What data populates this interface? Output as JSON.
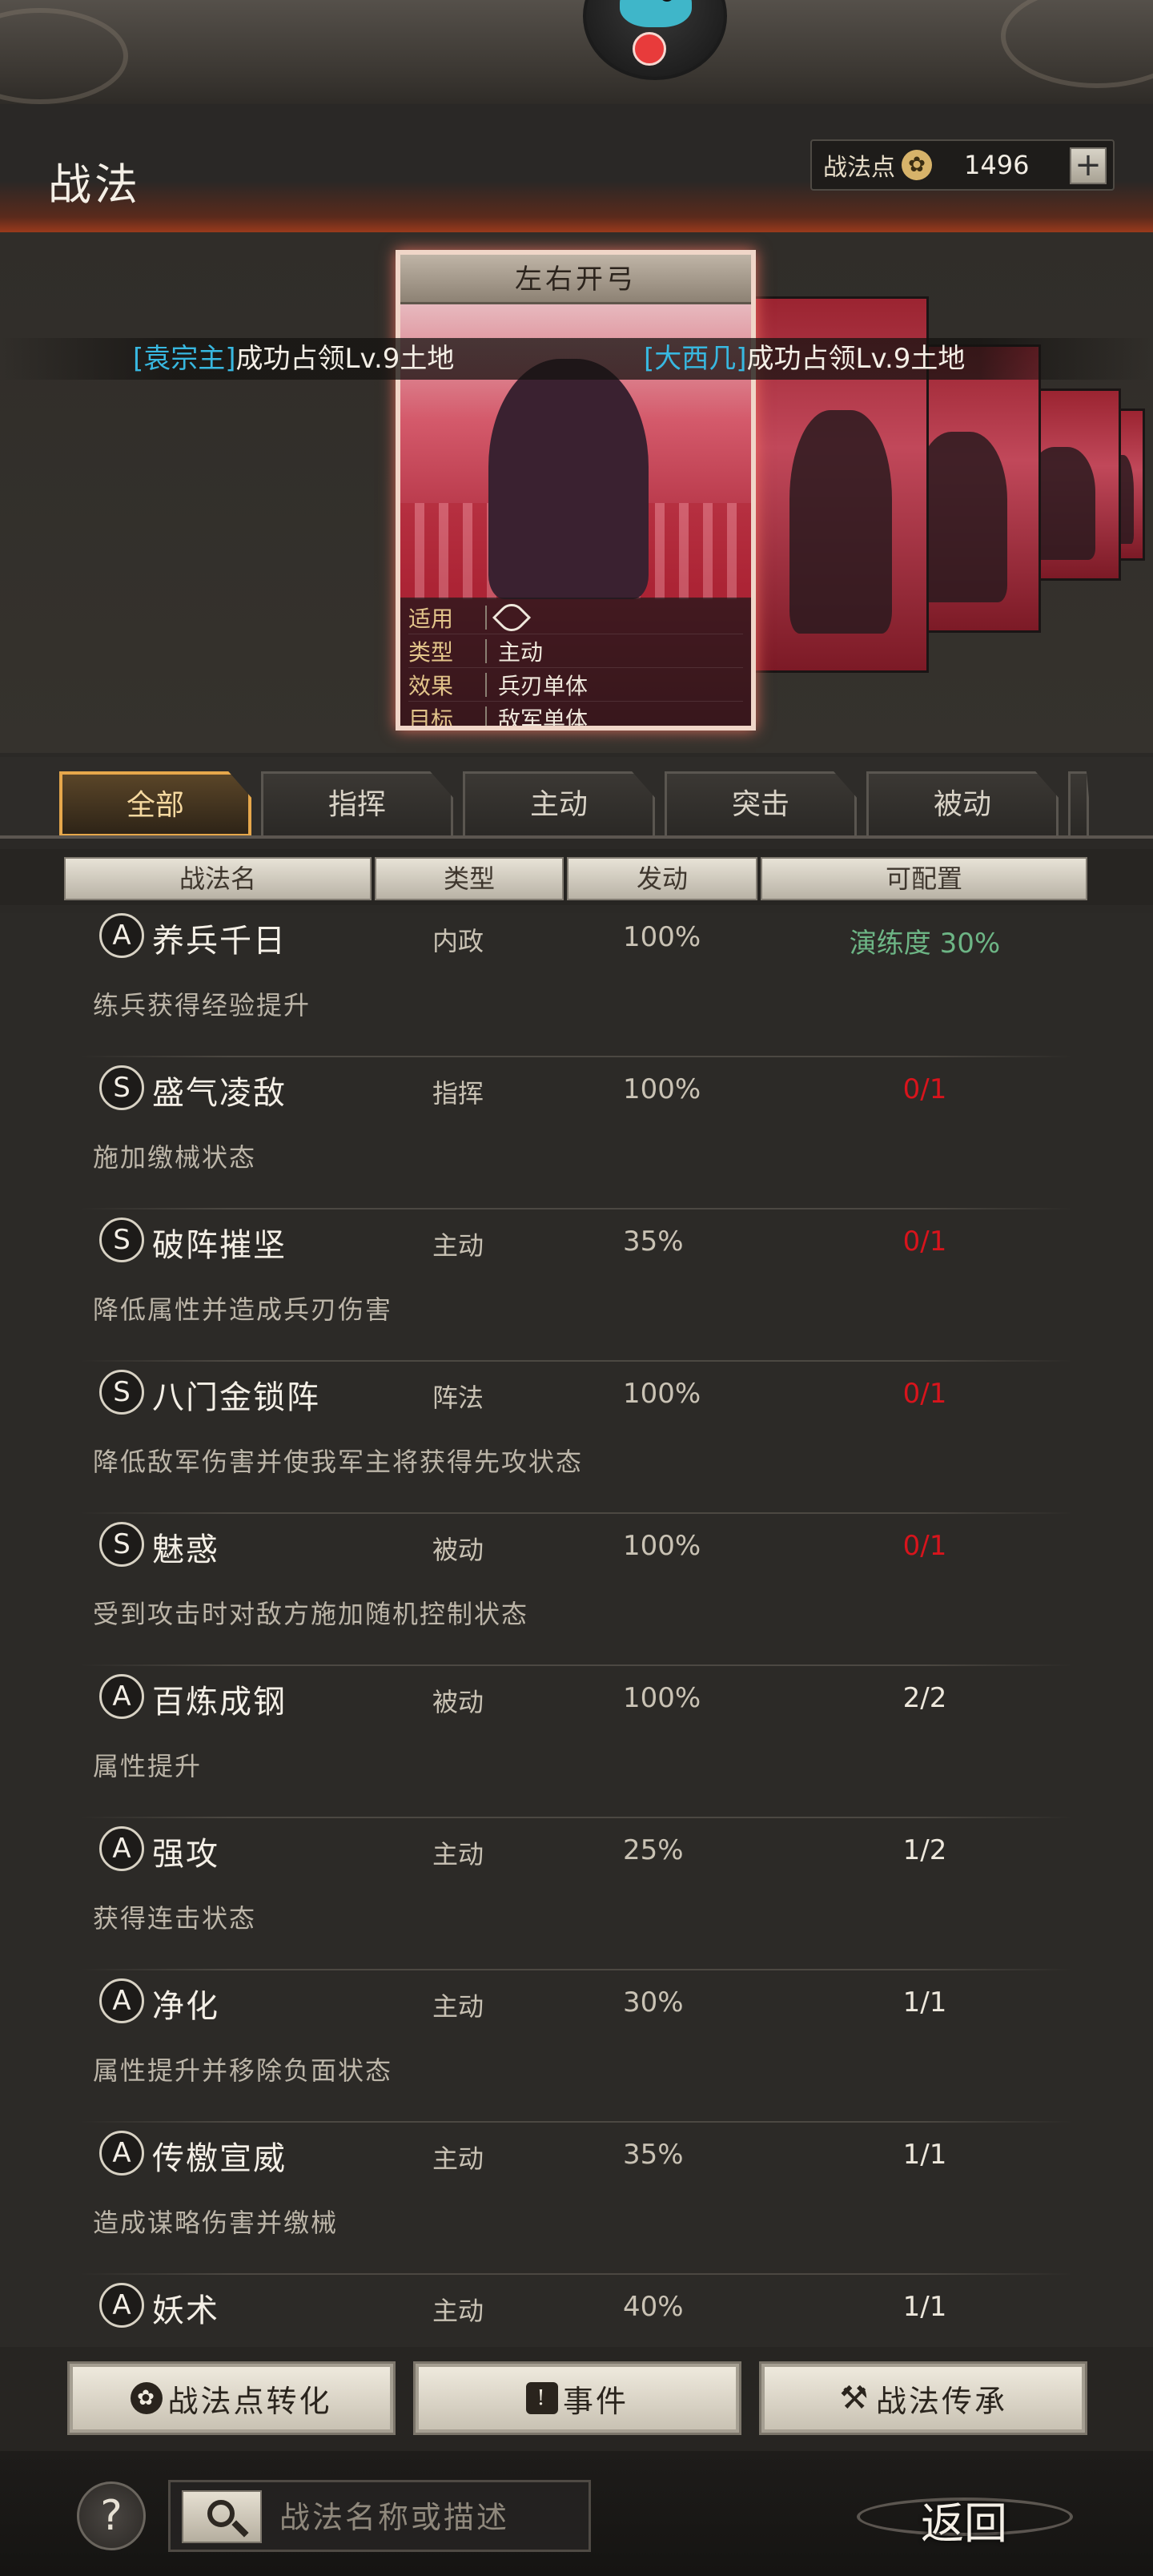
{
  "header": {
    "title": "战法",
    "points_label": "战法点",
    "points_icon": "feather-coin-icon",
    "points_value": "1496",
    "add_label": "+"
  },
  "notification": {
    "dot_color": "#e83b3b"
  },
  "featured_card": {
    "title": "左右开弓",
    "info": [
      {
        "key": "适用",
        "value": "",
        "icon": "bow-icon"
      },
      {
        "key": "类型",
        "value": "主动"
      },
      {
        "key": "效果",
        "value": "兵刃单体"
      },
      {
        "key": "目标",
        "value": "敌军单体"
      }
    ]
  },
  "ticker": [
    {
      "name": "[袁宗主]",
      "text": "成功占领Lv.9土地"
    },
    {
      "name": "[大西几]",
      "text": "成功占领Lv.9土地"
    }
  ],
  "tabs": [
    "全部",
    "指挥",
    "主动",
    "突击",
    "被动"
  ],
  "active_tab": "全部",
  "columns": [
    "战法名",
    "类型",
    "发动",
    "可配置"
  ],
  "skills": [
    {
      "grade": "A",
      "name": "养兵千日",
      "type": "内政",
      "rate": "100%",
      "config": "演练度 30%",
      "config_color": "green",
      "desc": "练兵获得经验提升"
    },
    {
      "grade": "S",
      "name": "盛气凌敌",
      "type": "指挥",
      "rate": "100%",
      "config": "0/1",
      "config_color": "red",
      "desc": "施加缴械状态"
    },
    {
      "grade": "S",
      "name": "破阵摧坚",
      "type": "主动",
      "rate": "35%",
      "config": "0/1",
      "config_color": "red",
      "desc": "降低属性并造成兵刃伤害"
    },
    {
      "grade": "S",
      "name": "八门金锁阵",
      "type": "阵法",
      "rate": "100%",
      "config": "0/1",
      "config_color": "red",
      "desc": "降低敌军伤害并使我军主将获得先攻状态"
    },
    {
      "grade": "S",
      "name": "魅惑",
      "type": "被动",
      "rate": "100%",
      "config": "0/1",
      "config_color": "red",
      "desc": "受到攻击时对敌方施加随机控制状态"
    },
    {
      "grade": "A",
      "name": "百炼成钢",
      "type": "被动",
      "rate": "100%",
      "config": "2/2",
      "config_color": "white",
      "desc": "属性提升"
    },
    {
      "grade": "A",
      "name": "强攻",
      "type": "主动",
      "rate": "25%",
      "config": "1/2",
      "config_color": "white",
      "desc": "获得连击状态"
    },
    {
      "grade": "A",
      "name": "净化",
      "type": "主动",
      "rate": "30%",
      "config": "1/1",
      "config_color": "white",
      "desc": "属性提升并移除负面状态"
    },
    {
      "grade": "A",
      "name": "传檄宣威",
      "type": "主动",
      "rate": "35%",
      "config": "1/1",
      "config_color": "white",
      "desc": "造成谋略伤害并缴械"
    },
    {
      "grade": "A",
      "name": "妖术",
      "type": "主动",
      "rate": "40%",
      "config": "1/1",
      "config_color": "white",
      "desc": ""
    }
  ],
  "actions": [
    {
      "label": "战法点转化",
      "icon": "feather-coin-icon"
    },
    {
      "label": "事件",
      "icon": "event-book-icon"
    },
    {
      "label": "战法传承",
      "icon": "hammer-icon"
    }
  ],
  "footer": {
    "help_label": "?",
    "search_placeholder": "战法名称或描述",
    "back_label": "返回"
  }
}
